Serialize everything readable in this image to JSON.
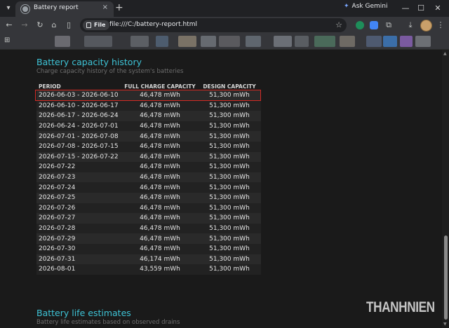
{
  "browser": {
    "tab_title": "Battery report",
    "close_glyph": "×",
    "new_tab_glyph": "+",
    "ask_gemini_label": "Ask Gemini",
    "chip_label": "File",
    "url": "file:///C:/battery-report.html",
    "icons": [
      "tab-search-icon",
      "back-icon",
      "forward-icon",
      "reload-icon",
      "home-icon",
      "side-panel-icon",
      "bookmark-star-icon",
      "download-icon",
      "profile-avatar"
    ]
  },
  "capacity_history": {
    "title": "Battery capacity history",
    "subtitle": "Charge capacity history of the system's batteries",
    "columns": [
      "PERIOD",
      "FULL CHARGE CAPACITY",
      "DESIGN CAPACITY"
    ],
    "rows": [
      [
        "2026-06-03 - 2026-06-10",
        "46,478 mWh",
        "51,300 mWh"
      ],
      [
        "2026-06-10 - 2026-06-17",
        "46,478 mWh",
        "51,300 mWh"
      ],
      [
        "2026-06-17 - 2026-06-24",
        "46,478 mWh",
        "51,300 mWh"
      ],
      [
        "2026-06-24 - 2026-07-01",
        "46,478 mWh",
        "51,300 mWh"
      ],
      [
        "2026-07-01 - 2026-07-08",
        "46,478 mWh",
        "51,300 mWh"
      ],
      [
        "2026-07-08 - 2026-07-15",
        "46,478 mWh",
        "51,300 mWh"
      ],
      [
        "2026-07-15 - 2026-07-22",
        "46,478 mWh",
        "51,300 mWh"
      ],
      [
        "2026-07-22",
        "46,478 mWh",
        "51,300 mWh"
      ],
      [
        "2026-07-23",
        "46,478 mWh",
        "51,300 mWh"
      ],
      [
        "2026-07-24",
        "46,478 mWh",
        "51,300 mWh"
      ],
      [
        "2026-07-25",
        "46,478 mWh",
        "51,300 mWh"
      ],
      [
        "2026-07-26",
        "46,478 mWh",
        "51,300 mWh"
      ],
      [
        "2026-07-27",
        "46,478 mWh",
        "51,300 mWh"
      ],
      [
        "2026-07-28",
        "46,478 mWh",
        "51,300 mWh"
      ],
      [
        "2026-07-29",
        "46,478 mWh",
        "51,300 mWh"
      ],
      [
        "2026-07-30",
        "46,478 mWh",
        "51,300 mWh"
      ],
      [
        "2026-07-31",
        "46,174 mWh",
        "51,300 mWh"
      ],
      [
        "2026-08-01",
        "43,559 mWh",
        "51,300 mWh"
      ]
    ],
    "highlight_color": "#d42a24"
  },
  "life_estimates": {
    "title": "Battery life estimates",
    "subtitle": "Battery life estimates based on observed drains"
  },
  "watermark": "THANHNIEN",
  "colors": {
    "accent": "#3ec3d6",
    "page_bg": "#1a1a1a",
    "row_odd": "#2a2a2a",
    "row_even": "#222222"
  }
}
